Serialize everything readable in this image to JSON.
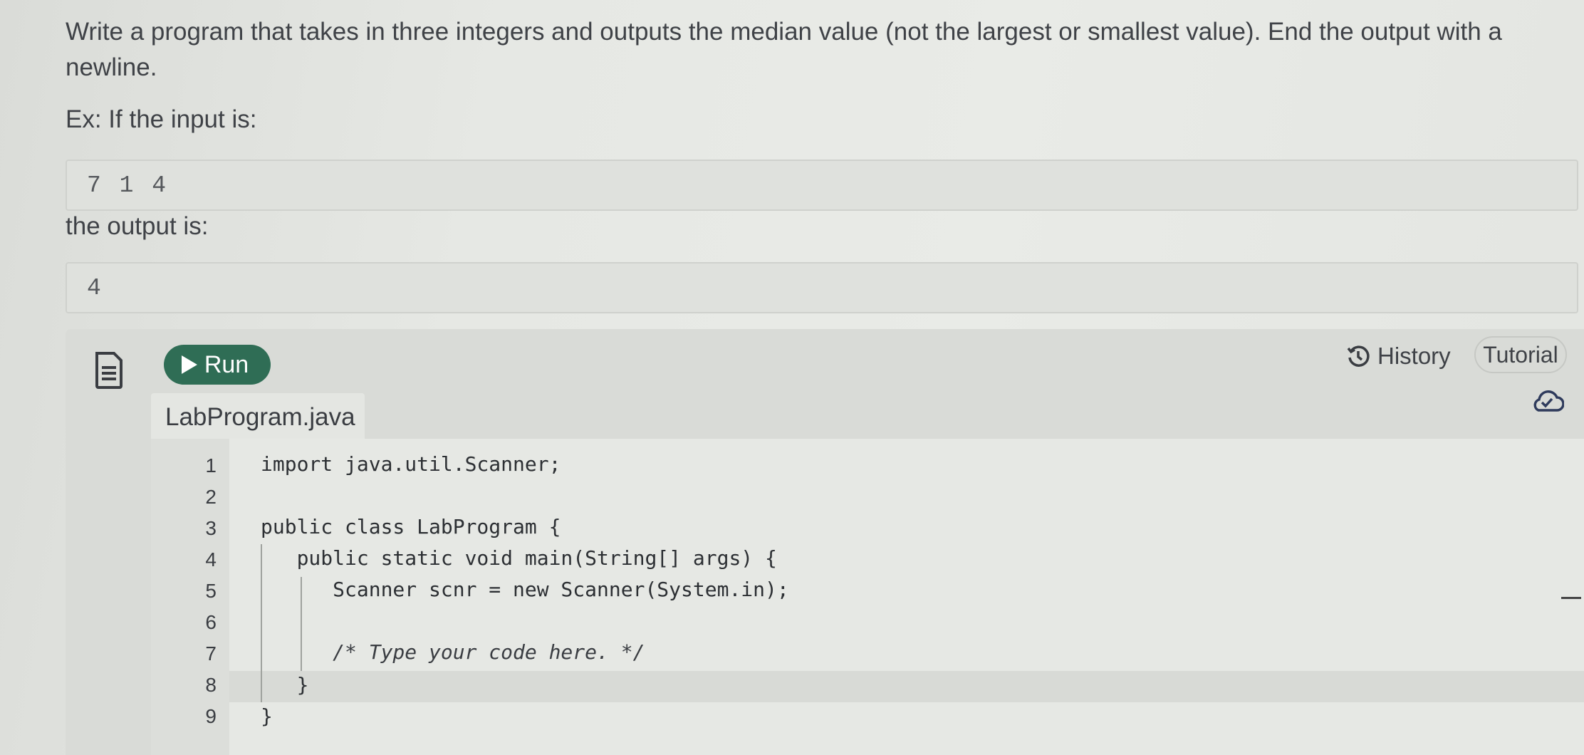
{
  "prompt": {
    "text": "Write a program that takes in three integers and outputs the median value (not the largest or smallest value). End the output with a newline.",
    "input_label": "Ex: If the input is:",
    "input_value": "7 1 4",
    "output_label": "the output is:",
    "output_value": "4"
  },
  "toolbar": {
    "run_label": "Run",
    "history_label": "History",
    "tutorial_label": "Tutorial"
  },
  "editor": {
    "filename": "LabProgram.java",
    "lines": [
      {
        "num": "1",
        "code": "import java.util.Scanner;"
      },
      {
        "num": "2",
        "code": ""
      },
      {
        "num": "3",
        "code": "public class LabProgram {"
      },
      {
        "num": "4",
        "code": "   public static void main(String[] args) {"
      },
      {
        "num": "5",
        "code": "      Scanner scnr = new Scanner(System.in);"
      },
      {
        "num": "6",
        "code": ""
      },
      {
        "num": "7",
        "code": "      /* Type your code here. */"
      },
      {
        "num": "8",
        "code": "   }"
      },
      {
        "num": "9",
        "code": "}"
      }
    ]
  },
  "icons": {
    "run": "play-icon",
    "history": "history-icon",
    "save_status": "cloud-check-icon",
    "instructions": "document-icon"
  },
  "colors": {
    "run_button": "#2f6d55"
  }
}
